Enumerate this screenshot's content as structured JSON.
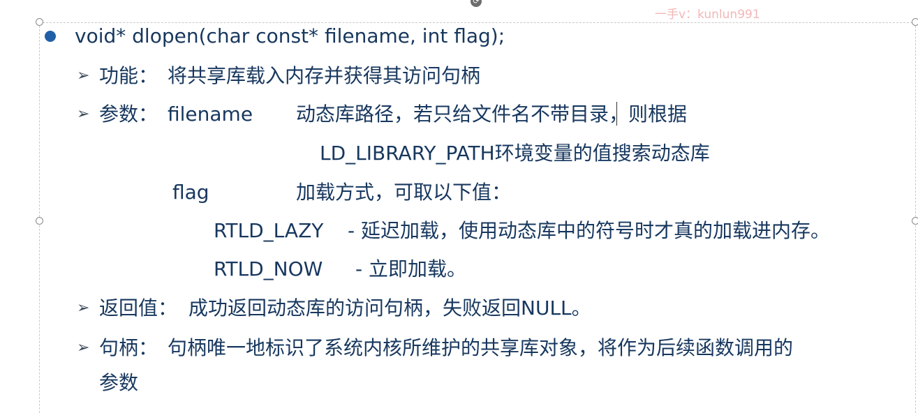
{
  "watermark": "一手v：kunlun991",
  "signature": "void* dlopen(char const* filename, int flag);",
  "function": {
    "label": "功能：",
    "text": "将共享库载入内存并获得其访问句柄"
  },
  "params": {
    "label": "参数：",
    "filename": {
      "name": "filename",
      "desc1": "动态库路径，若只给文件名不带目录，则根据",
      "desc2": "LD_LIBRARY_PATH环境变量的值搜索动态库"
    },
    "flag": {
      "name": "flag",
      "desc": "加载方式，可取以下值："
    },
    "values": [
      {
        "name": "RTLD_LAZY",
        "desc": "- 延迟加载，使用动态库中的符号时才真的加载进内存。"
      },
      {
        "name": "RTLD_NOW",
        "desc": "- 立即加载。"
      }
    ]
  },
  "return": {
    "label": "返回值：",
    "text": "成功返回动态库的访问句柄，失败返回NULL。"
  },
  "handle": {
    "label": "句柄：",
    "text1": "句柄唯一地标识了系统内核所维护的共享库对象，将作为后续函数调用的",
    "text2": "参数"
  },
  "icons": {
    "bullet": "filled-circle-bullet",
    "sub_bullet": "arrow-bullet",
    "rotate": "rotate-handle-icon"
  },
  "colors": {
    "text": "#17375e",
    "bullet": "#1f5fa8",
    "watermark": "#f2b7b7"
  }
}
